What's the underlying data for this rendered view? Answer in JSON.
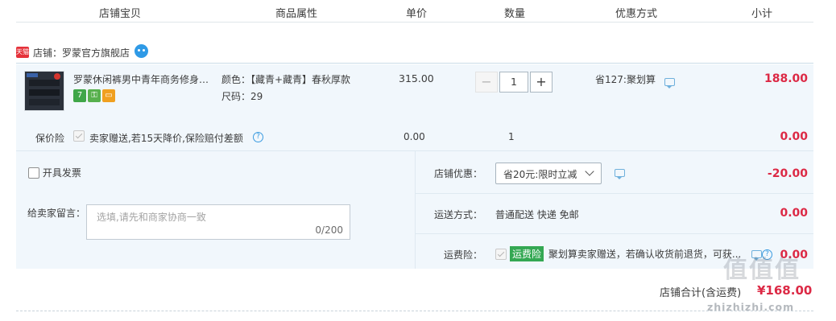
{
  "header": {
    "columns": [
      "店铺宝贝",
      "商品属性",
      "单价",
      "数量",
      "优惠方式",
      "小计"
    ]
  },
  "store": {
    "badge": "天猫",
    "name": "店铺：罗蒙官方旗舰店"
  },
  "item": {
    "title": "罗蒙休闲裤男中青年商务修身西...",
    "attr_color": "颜色：【藏青+藏青】春秋厚款",
    "attr_size": "尺码：29",
    "service_icons": [
      "7",
      "gift-icon",
      "card-icon"
    ],
    "price": "315.00",
    "quantity": "1",
    "discount": "省127:聚划算",
    "subtotal": "188.00"
  },
  "protection": {
    "label": "保价险",
    "text": "卖家赠送,若15天降价,保险赔付差额",
    "price": "0.00",
    "quantity": "1",
    "subtotal": "0.00"
  },
  "invoice": {
    "label": "开具发票"
  },
  "message": {
    "label": "给卖家留言：",
    "placeholder": "选填,请先和商家协商一致",
    "counter": "0/200"
  },
  "store_discount": {
    "label": "店铺优惠：",
    "selected": "省20元:限时立减",
    "amount": "-20.00"
  },
  "shipping": {
    "label": "运送方式：",
    "value": "普通配送 快递 免邮",
    "amount": "0.00"
  },
  "freight_insurance": {
    "label": "运费险：",
    "tag": "运费险",
    "text": "聚划算卖家赠送，若确认收货前退货，可获...",
    "amount": "0.00"
  },
  "total": {
    "label": "店铺合计(含运费)",
    "amount": "¥168.00"
  },
  "watermark": {
    "big": "值值值",
    "small": "zhizhizhi.com"
  },
  "colors": {
    "accent_red": "#dc2945",
    "panel_bg": "#f1f7fc",
    "link_blue": "#3a9be0",
    "insurance_green": "#34a853"
  }
}
